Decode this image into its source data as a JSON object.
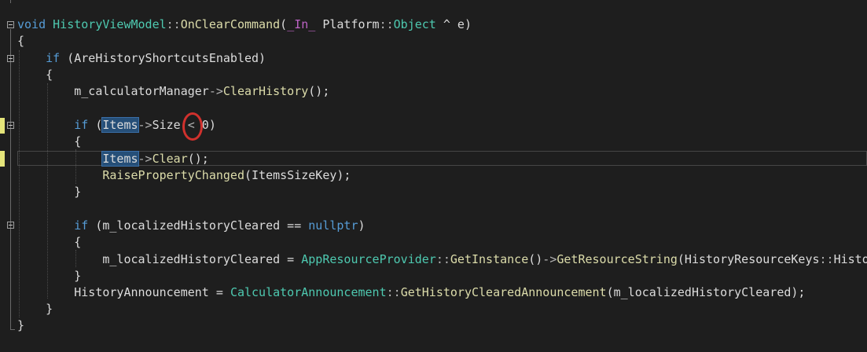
{
  "editor": {
    "lines": [
      {
        "id": "l1",
        "parts": [
          [
            "kw",
            "void"
          ],
          [
            "",
            "",
            ""
          ],
          [
            "type",
            " HistoryViewModel"
          ],
          [
            "scope",
            "::"
          ],
          [
            "fn",
            "OnClearCommand"
          ],
          [
            "",
            "("
          ],
          [
            "macro",
            "_In_"
          ],
          [
            "",
            " Platform"
          ],
          [
            "scope",
            "::"
          ],
          [
            "type",
            "Object"
          ],
          [
            "",
            " ^ e)"
          ]
        ]
      },
      {
        "id": "l2",
        "parts": [
          [
            "",
            "{"
          ]
        ]
      },
      {
        "id": "l3",
        "parts": [
          [
            "",
            "    "
          ],
          [
            "kw",
            "if"
          ],
          [
            "",
            " (AreHistoryShortcutsEnabled)"
          ]
        ]
      },
      {
        "id": "l4",
        "parts": [
          [
            "",
            "    {"
          ]
        ]
      },
      {
        "id": "l5",
        "parts": [
          [
            "",
            "        m_calculatorManager"
          ],
          [
            "op",
            "->"
          ],
          [
            "fn",
            "ClearHistory"
          ],
          [
            "",
            "();"
          ]
        ]
      },
      {
        "id": "l6",
        "parts": [
          [
            "",
            "        "
          ]
        ]
      },
      {
        "id": "l7",
        "parts": [
          [
            "",
            "        "
          ],
          [
            "kw",
            "if"
          ],
          [
            "",
            " ("
          ],
          [
            "hl",
            "Items"
          ],
          [
            "op",
            "->"
          ],
          [
            "",
            "Size "
          ],
          [
            "op",
            "<"
          ],
          [
            "",
            " 0)"
          ]
        ]
      },
      {
        "id": "l8",
        "parts": [
          [
            "",
            "        {"
          ]
        ]
      },
      {
        "id": "l9",
        "parts": [
          [
            "",
            "            "
          ],
          [
            "hl",
            "Items"
          ],
          [
            "op",
            "->"
          ],
          [
            "fn",
            "Clear"
          ],
          [
            "",
            "();"
          ]
        ]
      },
      {
        "id": "l10",
        "parts": [
          [
            "",
            "            "
          ],
          [
            "fn",
            "RaisePropertyChanged"
          ],
          [
            "",
            "(ItemsSizeKey);"
          ]
        ]
      },
      {
        "id": "l11",
        "parts": [
          [
            "",
            "        }"
          ]
        ]
      },
      {
        "id": "l12",
        "parts": [
          [
            "",
            ""
          ]
        ]
      },
      {
        "id": "l13",
        "parts": [
          [
            "",
            "        "
          ],
          [
            "kw",
            "if"
          ],
          [
            "",
            " (m_localizedHistoryCleared == "
          ],
          [
            "kw",
            "nullptr"
          ],
          [
            "",
            ")"
          ]
        ]
      },
      {
        "id": "l14",
        "parts": [
          [
            "",
            "        {"
          ]
        ]
      },
      {
        "id": "l15",
        "parts": [
          [
            "",
            "            m_localizedHistoryCleared = "
          ],
          [
            "type",
            "AppResourceProvider"
          ],
          [
            "scope",
            "::"
          ],
          [
            "fn",
            "GetInstance"
          ],
          [
            "",
            "()"
          ],
          [
            "op",
            "->"
          ],
          [
            "fn",
            "GetResourceString"
          ],
          [
            "",
            "(HistoryResourceKeys"
          ],
          [
            "scope",
            "::"
          ],
          [
            "",
            "Histo"
          ]
        ]
      },
      {
        "id": "l16",
        "parts": [
          [
            "",
            "        }"
          ]
        ]
      },
      {
        "id": "l17",
        "parts": [
          [
            "",
            "        HistoryAnnouncement = "
          ],
          [
            "type",
            "CalculatorAnnouncement"
          ],
          [
            "scope",
            "::"
          ],
          [
            "fn",
            "GetHistoryClearedAnnouncement"
          ],
          [
            "",
            "(m_localizedHistoryCleared);"
          ]
        ]
      },
      {
        "id": "l18",
        "parts": [
          [
            "",
            "    }"
          ]
        ]
      },
      {
        "id": "l19",
        "parts": [
          [
            "",
            "}"
          ]
        ]
      }
    ]
  },
  "colors": {
    "background": "#1e1e1e",
    "keyword": "#569cd6",
    "type": "#4ec9b0",
    "function": "#dcdcaa",
    "macro": "#bd63c5",
    "highlight": "#264f78",
    "change_marker": "#e4e47a",
    "annotation": "#d0312d"
  },
  "icons": [
    "fold-collapse-icon",
    "change-marker-icon",
    "annotation-circle-icon"
  ]
}
